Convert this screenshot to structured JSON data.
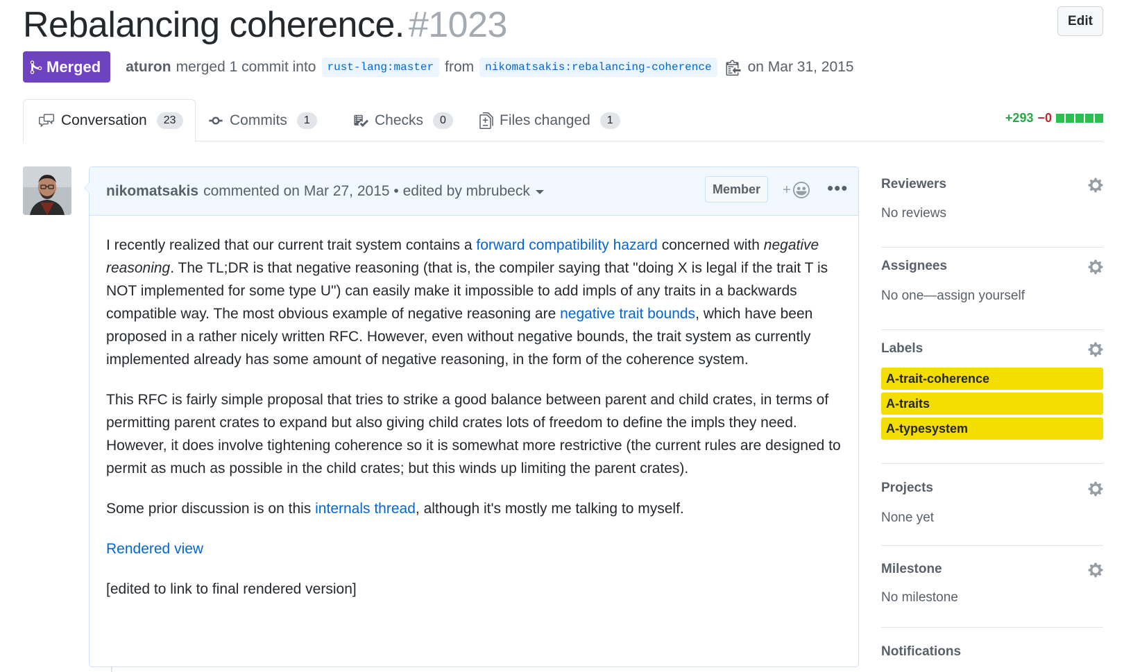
{
  "pr": {
    "title": "Rebalancing coherence.",
    "number": "#1023",
    "edit_label": "Edit",
    "state": "Merged",
    "merger": "aturon",
    "merged_text": "merged 1 commit into",
    "base_branch": "rust-lang:master",
    "from_text": "from",
    "head_branch": "nikomatsakis:rebalancing-coherence",
    "date_text": "on Mar 31, 2015"
  },
  "tabs": [
    {
      "label": "Conversation",
      "count": "23"
    },
    {
      "label": "Commits",
      "count": "1"
    },
    {
      "label": "Checks",
      "count": "0"
    },
    {
      "label": "Files changed",
      "count": "1"
    }
  ],
  "diffstat": {
    "additions": "+293",
    "deletions": "−0"
  },
  "comment": {
    "author": "nikomatsakis",
    "action": "commented on Mar 27, 2015 • edited by mbrubeck",
    "badge": "Member",
    "react_plus": "+",
    "more": "•••",
    "p1_a": "I recently realized that our current trait system contains a ",
    "p1_link1": "forward compatibility hazard",
    "p1_b": " concerned with ",
    "p1_em": "negative reasoning",
    "p1_c": ". The TL;DR is that negative reasoning (that is, the compiler saying that \"doing X is legal if the trait T is NOT implemented for some type U\") can easily make it impossible to add impls of any traits in a backwards compatible way. The most obvious example of negative reasoning are ",
    "p1_link2": "negative trait bounds",
    "p1_d": ", which have been proposed in a rather nicely written RFC. However, even without negative bounds, the trait system as currently implemented already has some amount of negative reasoning, in the form of the coherence system.",
    "p2": "This RFC is fairly simple proposal that tries to strike a good balance between parent and child crates, in terms of permitting parent crates to expand but also giving child crates lots of freedom to define the impls they need. However, it does involve tightening coherence so it is somewhat more restrictive (the current rules are designed to permit as much as possible in the child crates; but this winds up limiting the parent crates).",
    "p3_a": "Some prior discussion is on this ",
    "p3_link": "internals thread",
    "p3_b": ", although it's mostly me talking to myself.",
    "p4_link": "Rendered view",
    "p5": "[edited to link to final rendered version]"
  },
  "sidebar": {
    "reviewers": {
      "heading": "Reviewers",
      "value": "No reviews"
    },
    "assignees": {
      "heading": "Assignees",
      "value": "No one—assign yourself"
    },
    "labels": {
      "heading": "Labels",
      "items": [
        "A-trait-coherence",
        "A-traits",
        "A-typesystem"
      ],
      "color": "#f4dd00"
    },
    "projects": {
      "heading": "Projects",
      "value": "None yet"
    },
    "milestone": {
      "heading": "Milestone",
      "value": "No milestone"
    },
    "notifications": {
      "heading": "Notifications"
    }
  },
  "colors": {
    "merged": "#6f42c1",
    "link": "#0366d6",
    "added": "#28a745",
    "deleted": "#cb2431"
  }
}
